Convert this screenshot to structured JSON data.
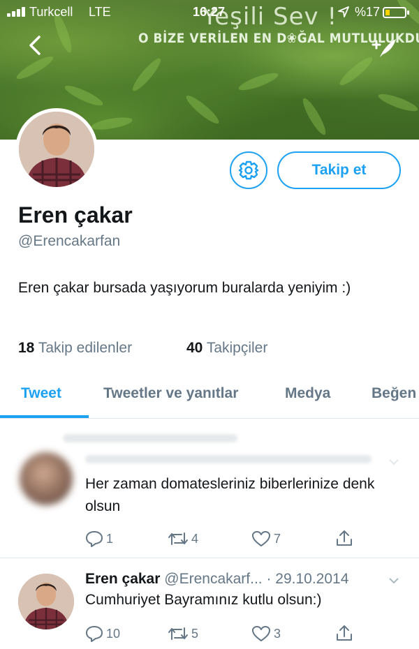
{
  "status_bar": {
    "carrier": "Turkcell",
    "network": "LTE",
    "time": "16:27",
    "battery_percent": "%17",
    "icons": [
      "signal-icon",
      "location-arrow-icon",
      "battery-icon"
    ]
  },
  "banner": {
    "title": "Yeşili Sev !",
    "subtitle": "O BİZE VERİLEN EN D❀ĞAL MUTLULUKDUR",
    "back_icon": "back-chevron-icon",
    "compose_icon": "compose-feather-icon"
  },
  "profile": {
    "name": "Eren çakar",
    "handle": "@Erencakarfan",
    "bio": "Eren çakar bursada yaşıyorum buralarda yeniyim :)",
    "following_count": "18",
    "following_label": "Takip edilenler",
    "followers_count": "40",
    "followers_label": "Takipçiler",
    "follow_button": "Takip et",
    "settings_icon": "gear-icon"
  },
  "tabs": [
    {
      "label": "Tweet",
      "active": true
    },
    {
      "label": "Tweetler ve yanıtlar",
      "active": false
    },
    {
      "label": "Medya",
      "active": false
    },
    {
      "label": "Beğen",
      "active": false
    }
  ],
  "tweets": [
    {
      "blurred_header": true,
      "text": "Her zaman domatesleriniz biberlerinize denk olsun",
      "replies": "1",
      "retweets": "4",
      "likes": "7"
    },
    {
      "name": "Eren çakar",
      "handle_date": "@Erencakarf... · 29.10.2014",
      "text": "Cumhuriyet Bayramınız kutlu olsun:)",
      "replies": "10",
      "retweets": "5",
      "likes": "3"
    }
  ],
  "colors": {
    "accent": "#1da1f2",
    "secondary_text": "#657786",
    "primary_text": "#14171a"
  }
}
